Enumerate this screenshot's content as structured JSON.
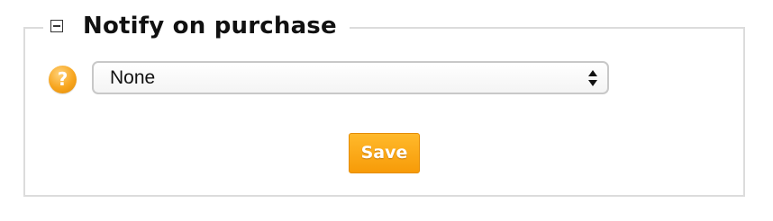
{
  "section": {
    "title": "Notify on purchase",
    "collapse_icon": "minus-box-icon"
  },
  "help": {
    "icon": "question-mark-icon",
    "glyph": "?",
    "color": "#f7a51e"
  },
  "select": {
    "value": "None",
    "icon": "up-down-arrows-icon"
  },
  "actions": {
    "save_label": "Save",
    "save_color": "#f79b08"
  }
}
